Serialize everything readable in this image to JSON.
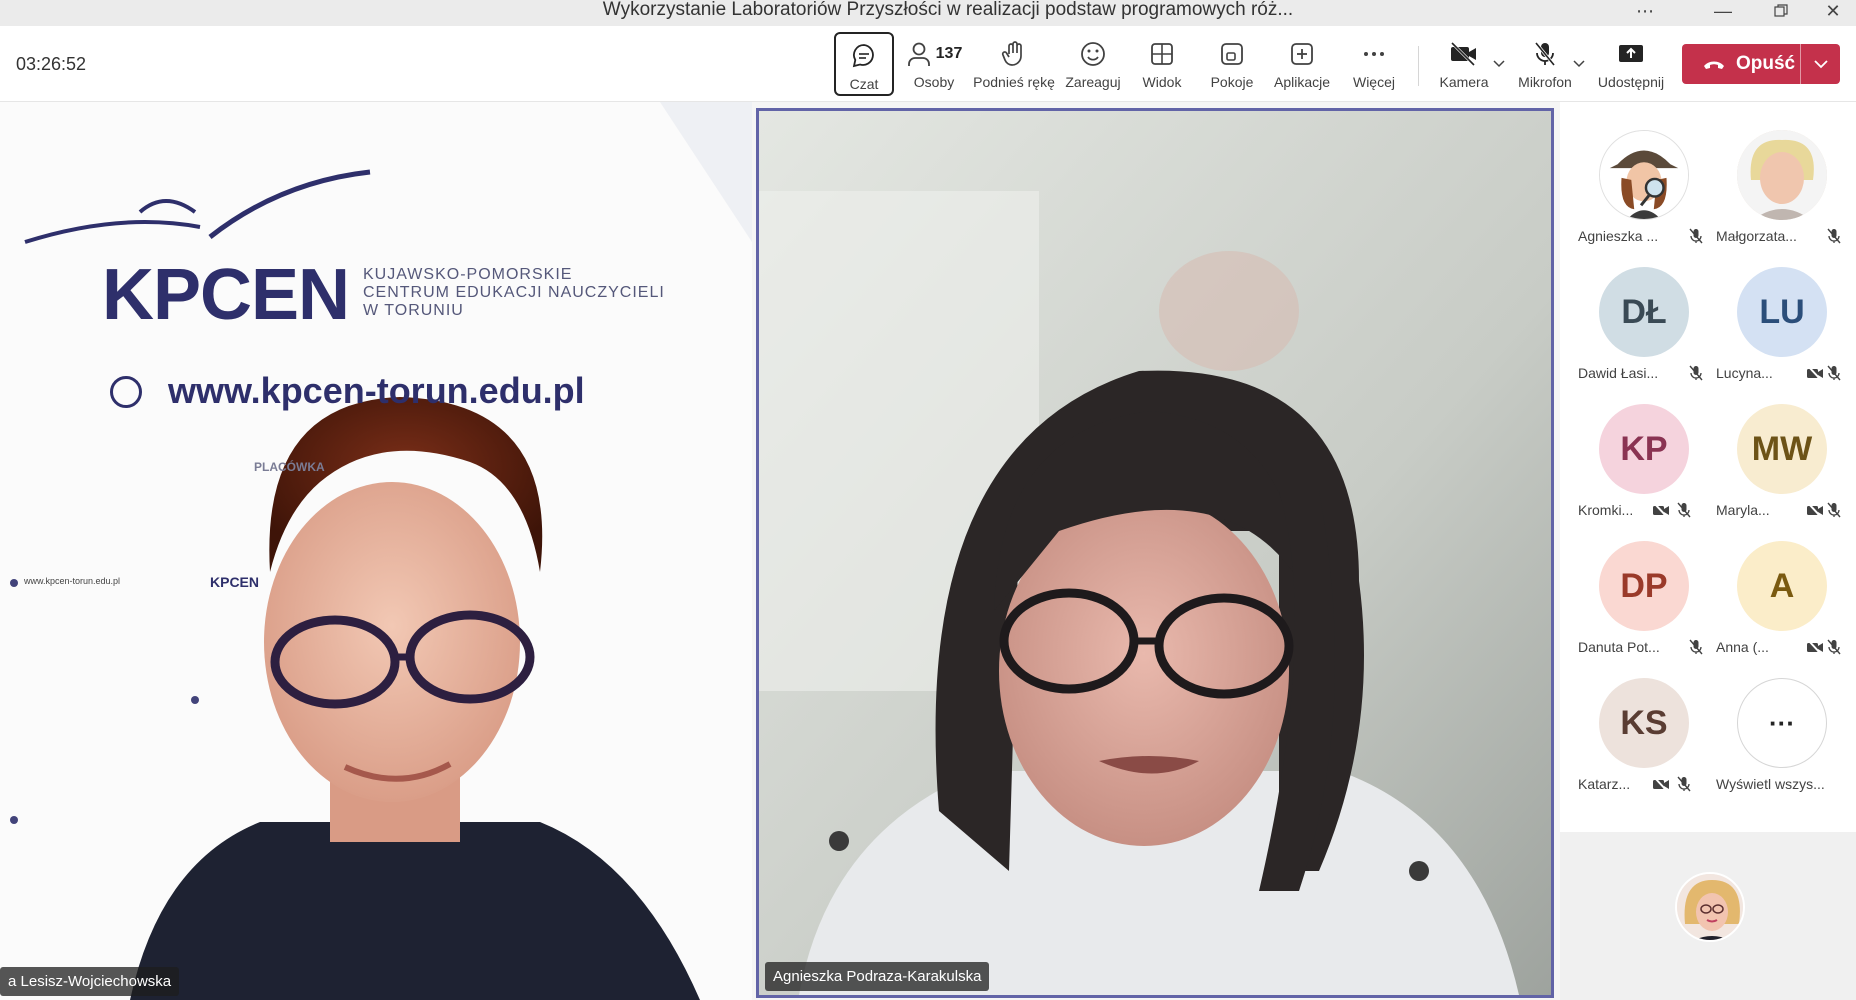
{
  "window": {
    "title": "Wykorzystanie Laboratoriów Przyszłości w realizacji podstaw programowych róż..."
  },
  "toolbar": {
    "timer": "03:26:52",
    "chat_label": "Czat",
    "people_label": "Osoby",
    "people_count": "137",
    "raise_hand_label": "Podnieś rękę",
    "react_label": "Zareaguj",
    "view_label": "Widok",
    "rooms_label": "Pokoje",
    "apps_label": "Aplikacje",
    "more_label": "Więcej",
    "camera_label": "Kamera",
    "mic_label": "Mikrofon",
    "share_label": "Udostępnij",
    "leave_label": "Opuść",
    "accent_color": "#6264a7",
    "leave_color": "#c4314b"
  },
  "stage": {
    "left_video": {
      "name": "a Lesisz-Wojciechowska",
      "backdrop": {
        "logo": "KPCEN",
        "org_line1": "KUJAWSKO-POMORSKIE",
        "org_line2": "CENTRUM EDUKACJI NAUCZYCIELI",
        "org_line3": "W TORUNIU",
        "url": "www.kpcen-torun.edu.pl",
        "small_label": "PLACÓWKA",
        "small_url": "www.kpcen-torun.edu.pl",
        "small_logo": "KPCEN"
      }
    },
    "center_video": {
      "name": "Agnieszka Podraza-Karakulska"
    }
  },
  "participants": [
    {
      "name": "Agnieszka ...",
      "initials": "",
      "avatar_bg": "#ffffff",
      "text_color": "#242424",
      "cam_off": false
    },
    {
      "name": "Małgorzata...",
      "initials": "",
      "avatar_bg": "#e8d8c8",
      "text_color": "#242424",
      "cam_off": false
    },
    {
      "name": "Dawid Łasi...",
      "initials": "DŁ",
      "avatar_bg": "#d0dde4",
      "text_color": "#3a4a55",
      "cam_off": false
    },
    {
      "name": "Lucyna...",
      "initials": "LU",
      "avatar_bg": "#d4e1f3",
      "text_color": "#2b4e7a",
      "cam_off": true
    },
    {
      "name": "Kromki...",
      "initials": "KP",
      "avatar_bg": "#f5d3dd",
      "text_color": "#8a3352",
      "cam_off": true
    },
    {
      "name": "Maryla...",
      "initials": "MW",
      "avatar_bg": "#f8ecd0",
      "text_color": "#6d5317",
      "cam_off": true
    },
    {
      "name": "Danuta Pot...",
      "initials": "DP",
      "avatar_bg": "#fad8d2",
      "text_color": "#9a3a2a",
      "cam_off": false
    },
    {
      "name": "Anna (...",
      "initials": "A",
      "avatar_bg": "#fbedc9",
      "text_color": "#7a5a10",
      "cam_off": true
    },
    {
      "name": "Katarz...",
      "initials": "KS",
      "avatar_bg": "#ede2dc",
      "text_color": "#5a3d33",
      "cam_off": true
    },
    {
      "name": "Wyświetl wszys...",
      "initials": "···",
      "avatar_bg": "#ffffff",
      "text_color": "#242424",
      "cam_off": false
    }
  ]
}
